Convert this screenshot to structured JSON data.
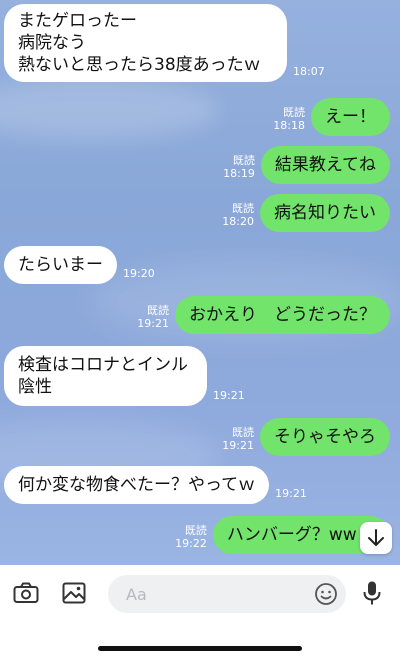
{
  "messages": [
    {
      "side": "in",
      "text": "またゲロったー\n病院なう\n熱ないと思ったら38度あったｗ",
      "time": "18:07"
    },
    {
      "side": "out",
      "text": "えー！",
      "read": "既読",
      "time": "18:18"
    },
    {
      "side": "out",
      "text": "結果教えてね",
      "read": "既読",
      "time": "18:19"
    },
    {
      "side": "out",
      "text": "病名知りたい",
      "read": "既読",
      "time": "18:20"
    },
    {
      "side": "in",
      "text": "たらいまー",
      "time": "19:20"
    },
    {
      "side": "out",
      "text": "おかえり　どうだった？",
      "read": "既読",
      "time": "19:21"
    },
    {
      "side": "in",
      "text": "検査はコロナとインル\n陰性",
      "time": "19:21"
    },
    {
      "side": "out",
      "text": "そりゃそやろ",
      "read": "既読",
      "time": "19:21"
    },
    {
      "side": "in",
      "text": "何か変な物食べたー？やってｗ",
      "time": "19:21"
    },
    {
      "side": "out",
      "text": "ハンバーグ？ww w",
      "read": "既読",
      "time": "19:22"
    }
  ],
  "input": {
    "placeholder": "Aa"
  },
  "icons": {
    "camera": "camera-icon",
    "image": "image-icon",
    "emoji": "emoji-icon",
    "mic": "mic-icon",
    "scroll": "arrow-down-icon"
  }
}
